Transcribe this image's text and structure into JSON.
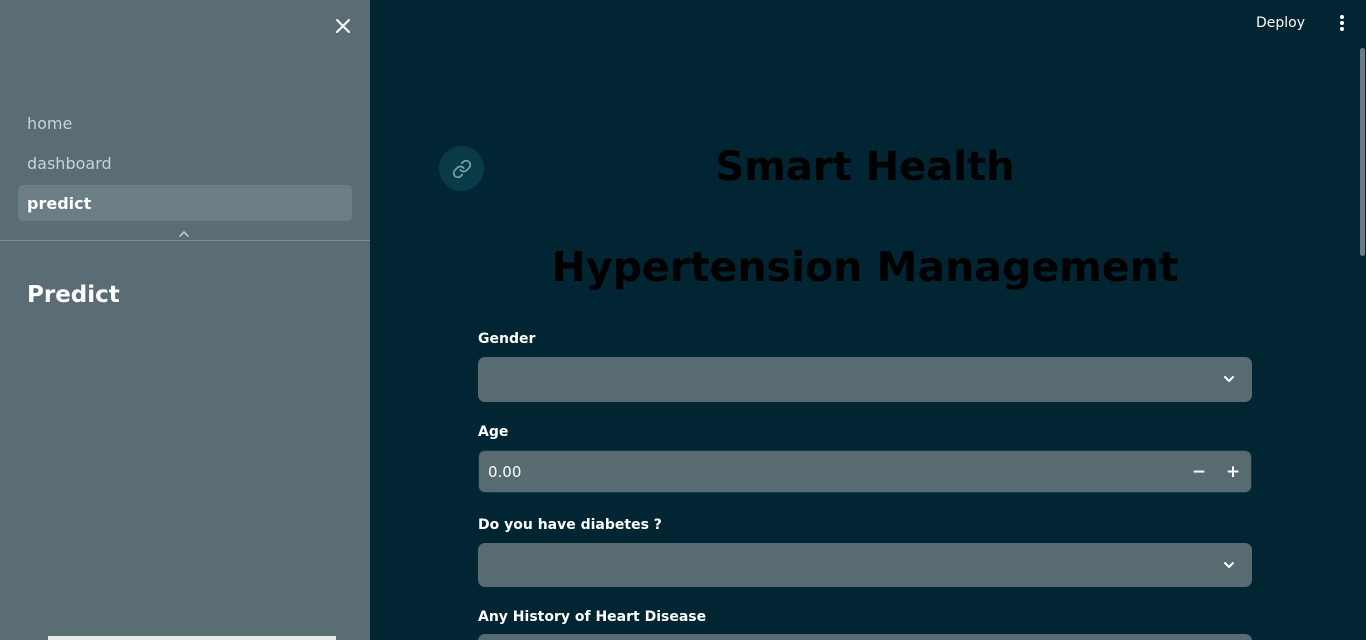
{
  "sidebar": {
    "close_icon": "close-icon",
    "nav": [
      {
        "label": "home",
        "active": false
      },
      {
        "label": "dashboard",
        "active": false
      },
      {
        "label": "predict",
        "active": true
      }
    ],
    "collapse_icon": "chevron-up-icon",
    "heading": "Predict"
  },
  "header": {
    "deploy_label": "Deploy",
    "menu_icon": "more-vertical-icon"
  },
  "main": {
    "anchor_icon": "link-icon",
    "title_line1": "Smart Health",
    "title_line2": "Hypertension Management",
    "form": {
      "gender_label": "Gender",
      "gender_value": "",
      "age_label": "Age",
      "age_value": "0.00",
      "age_minus": "−",
      "age_plus": "+",
      "diabetes_label": "Do you have diabetes ?",
      "diabetes_value": "",
      "heart_label": "Any History of Heart Disease"
    }
  },
  "colors": {
    "sidebar_bg": "#5a6d74",
    "main_bg": "#012533",
    "input_bg": "#586b71",
    "active_nav_bg": "#6b7e85"
  }
}
